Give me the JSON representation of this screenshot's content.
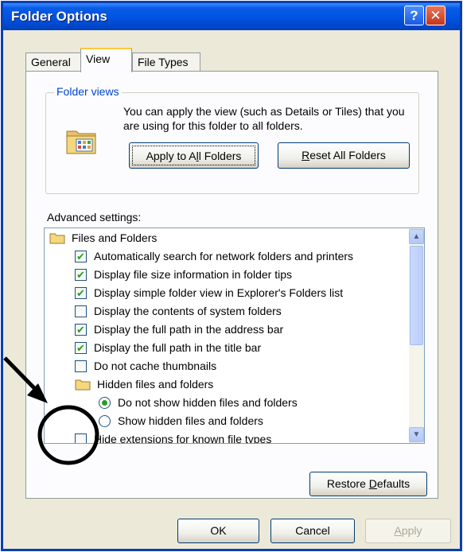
{
  "window": {
    "title": "Folder Options"
  },
  "titlebar_buttons": {
    "help_glyph": "?",
    "close_glyph": "✕",
    "help_icon": "help-icon",
    "close_icon": "close-icon"
  },
  "tabs": [
    {
      "label": "General",
      "active": false
    },
    {
      "label": "View",
      "active": true
    },
    {
      "label": "File Types",
      "active": false
    }
  ],
  "folder_views": {
    "legend": "Folder views",
    "icon": "folder-views-icon",
    "description": "You can apply the view (such as Details or Tiles) that you are using for this folder to all folders.",
    "apply_button": {
      "pre": "Apply to A",
      "mnemonic": "l",
      "post": "l Folders"
    },
    "reset_button": {
      "pre": "",
      "mnemonic": "R",
      "post": "eset All Folders"
    }
  },
  "advanced": {
    "label": "Advanced settings:",
    "items": [
      {
        "kind": "folder",
        "label": "Files and Folders"
      },
      {
        "kind": "checkbox",
        "checked": true,
        "label": "Automatically search for network folders and printers"
      },
      {
        "kind": "checkbox",
        "checked": true,
        "label": "Display file size information in folder tips"
      },
      {
        "kind": "checkbox",
        "checked": true,
        "label": "Display simple folder view in Explorer's Folders list"
      },
      {
        "kind": "checkbox",
        "checked": false,
        "label": "Display the contents of system folders"
      },
      {
        "kind": "checkbox",
        "checked": true,
        "label": "Display the full path in the address bar"
      },
      {
        "kind": "checkbox",
        "checked": true,
        "label": "Display the full path in the title bar"
      },
      {
        "kind": "checkbox",
        "checked": false,
        "label": "Do not cache thumbnails"
      },
      {
        "kind": "folder",
        "label": "Hidden files and folders"
      },
      {
        "kind": "radio",
        "selected": true,
        "label": "Do not show hidden files and folders"
      },
      {
        "kind": "radio",
        "selected": false,
        "label": "Show hidden files and folders"
      },
      {
        "kind": "checkbox",
        "checked": false,
        "label": "Hide extensions for known file types"
      }
    ],
    "scroll_up_glyph": "▲",
    "scroll_down_glyph": "▼"
  },
  "restore_button": {
    "pre": "Restore ",
    "mnemonic": "D",
    "post": "efaults"
  },
  "footer": {
    "ok": "OK",
    "cancel": "Cancel",
    "apply": {
      "pre": "",
      "mnemonic": "A",
      "post": "pply"
    }
  },
  "colors": {
    "title_bar": "#0054E3",
    "dialog_bg": "#ECE9D8",
    "legend_text": "#0046D5",
    "check_mark": "#21A121",
    "annotation": "#000000"
  }
}
